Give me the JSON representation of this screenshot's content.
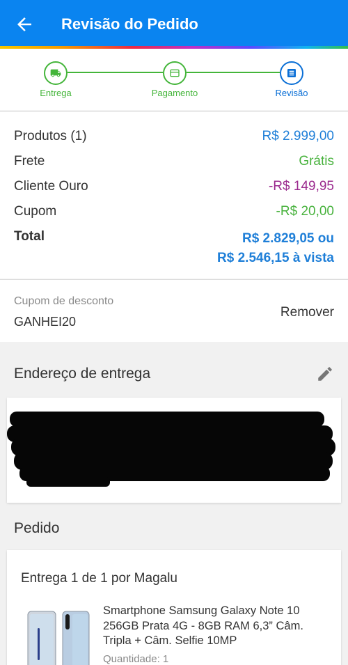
{
  "header": {
    "title": "Revisão do Pedido",
    "back_icon": "arrow-left-icon"
  },
  "steps": [
    {
      "label": "Entrega",
      "icon": "truck-icon",
      "state": "done"
    },
    {
      "label": "Pagamento",
      "icon": "card-icon",
      "state": "done"
    },
    {
      "label": "Revisão",
      "icon": "list-icon",
      "state": "current"
    }
  ],
  "summary": {
    "products_label": "Produtos (1)",
    "products_value": "R$ 2.999,00",
    "shipping_label": "Frete",
    "shipping_value": "Grátis",
    "gold_label": "Cliente Ouro",
    "gold_value": "-R$ 149,95",
    "coupon_label": "Cupom",
    "coupon_value": "-R$ 20,00",
    "total_label": "Total",
    "total_value_1": "R$ 2.829,05 ou",
    "total_value_2": "R$ 2.546,15 à vista"
  },
  "coupon": {
    "caption": "Cupom de desconto",
    "code": "GANHEI20",
    "remove_label": "Remover"
  },
  "address": {
    "title": "Endereço de entrega",
    "edit_icon": "pencil-icon"
  },
  "order": {
    "title": "Pedido",
    "delivery_label": "Entrega 1 de 1 por Magalu",
    "product_name": "Smartphone Samsung Galaxy Note 10 256GB Prata 4G - 8GB RAM 6,3” Câm. Tripla + Câm. Selfie 10MP",
    "quantity": "Quantidade:  1"
  },
  "colors": {
    "brand_blue": "#0a84f0",
    "step_green": "#44b53a",
    "price_blue": "#1f7fd8",
    "discount_purple": "#9b2a8e"
  }
}
